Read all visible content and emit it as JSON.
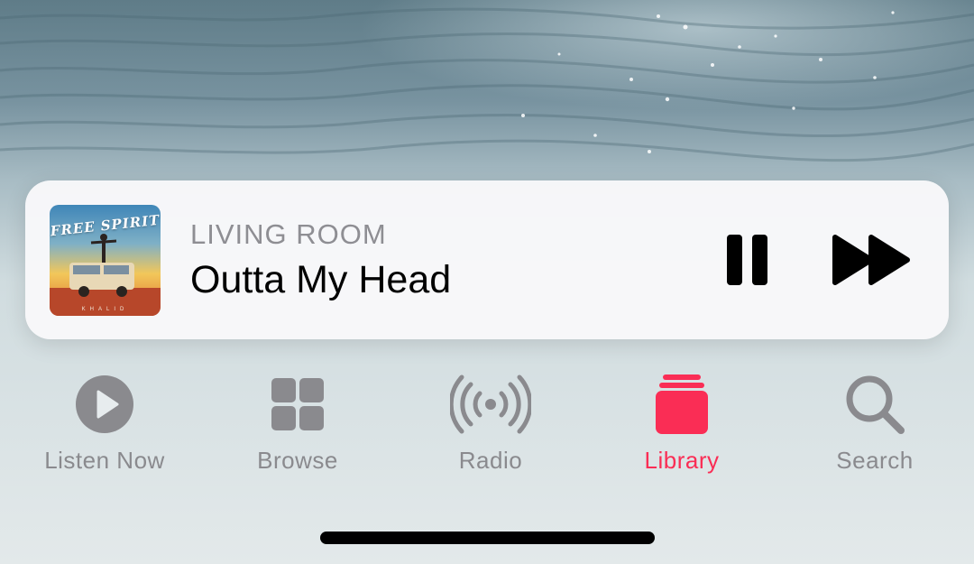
{
  "colors": {
    "accent": "#fa2d55",
    "inactive": "#8a8a8e",
    "secondary_text": "#8e8e93",
    "primary_text": "#000000"
  },
  "now_playing": {
    "artwork": {
      "album_title": "FREE SPIRIT",
      "artist": "KHALID",
      "icon": "album-artwork"
    },
    "device": "LIVING ROOM",
    "title": "Outta My Head",
    "controls": {
      "pause": {
        "icon": "pause-icon"
      },
      "skip": {
        "icon": "fast-forward-icon"
      }
    }
  },
  "tab_bar": {
    "active": "Library",
    "tabs": [
      {
        "label": "Listen Now",
        "icon": "play-circle-icon"
      },
      {
        "label": "Browse",
        "icon": "grid-icon"
      },
      {
        "label": "Radio",
        "icon": "radio-waves-icon"
      },
      {
        "label": "Library",
        "icon": "library-stack-icon"
      },
      {
        "label": "Search",
        "icon": "magnifier-icon"
      }
    ]
  }
}
